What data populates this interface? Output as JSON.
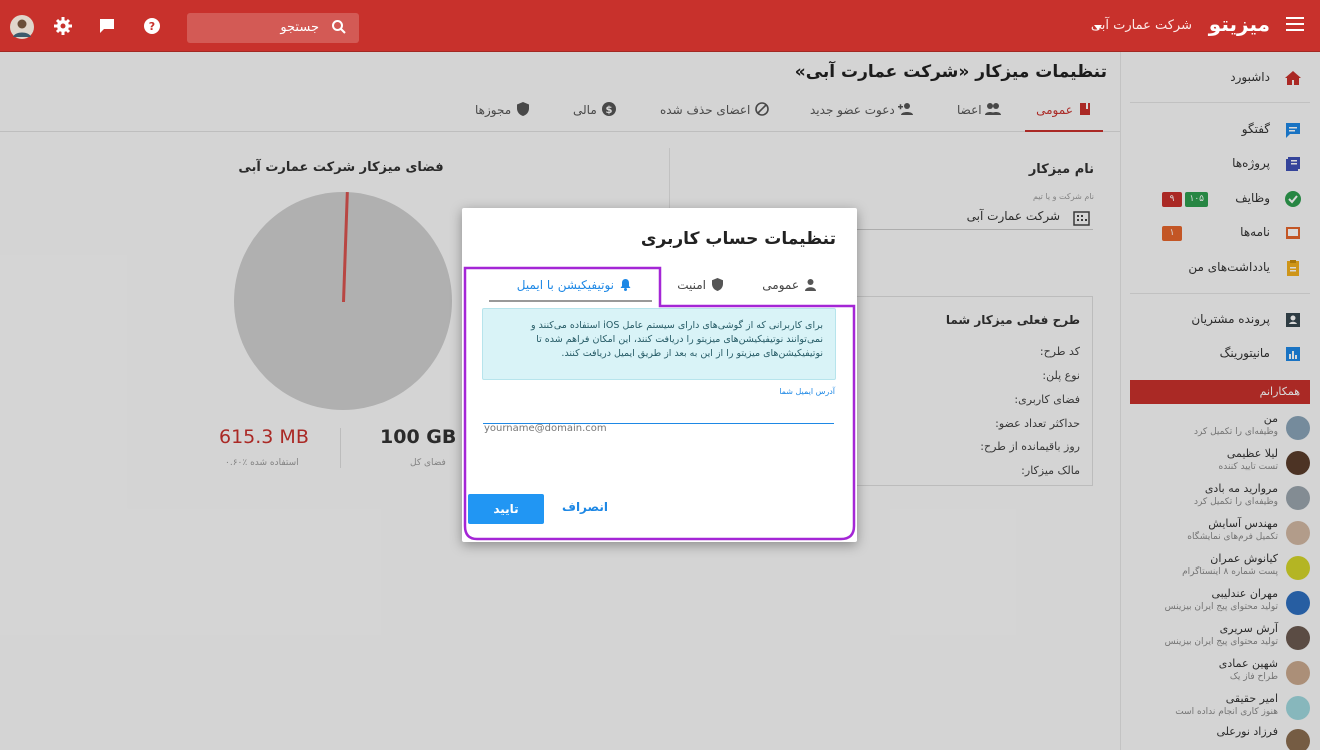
{
  "topbar": {
    "brand": "میزیتو",
    "company": "شرکت عمارت آبی",
    "search_placeholder": "جستجو",
    "icons": [
      "menu-icon",
      "search-icon",
      "help-icon",
      "chat-icon",
      "gear-icon",
      "user-avatar"
    ]
  },
  "page": {
    "title": "تنظیمات میزکار «شرکت عمارت آبی»",
    "tabs": [
      {
        "label": "عمومی",
        "icon": "book-icon",
        "active": true
      },
      {
        "label": "اعضا",
        "icon": "people-icon"
      },
      {
        "label": "دعوت عضو جدید",
        "icon": "person-add-icon"
      },
      {
        "label": "اعضای حذف شده",
        "icon": "block-icon"
      },
      {
        "label": "مالی",
        "icon": "dollar-icon"
      },
      {
        "label": "مجوزها",
        "icon": "shield-icon"
      }
    ]
  },
  "storage": {
    "title": "فضای میزکار شرکت عمارت آبی",
    "total_value": "100 GB",
    "total_label": "فضای کل",
    "used_value": "615.3 MB",
    "used_label": "۰.۶۰٪ استفاده شده",
    "used_fraction": 0.006
  },
  "workspace": {
    "name_title": "نام میزکار",
    "name_hint": "نام شرکت و یا تیم",
    "name_value": "شرکت عمارت آبی",
    "plan_title": "طرح فعلی میزکار شما",
    "plan_rows": [
      "کد طرح:",
      "نوع پلن:",
      "فضای کاربری:",
      "حداکثر تعداد عضو:",
      "روز باقیمانده از طرح:",
      "مالک میزکار:"
    ]
  },
  "sidebar": {
    "items": [
      {
        "label": "داشبورد",
        "icon": "home-icon"
      },
      {
        "label": "گفتگو",
        "icon": "chat-icon"
      },
      {
        "label": "پروژه‌ها",
        "icon": "projects-icon"
      },
      {
        "label": "وظایف",
        "icon": "check-icon",
        "badges": [
          "۱۰۵",
          "۹"
        ]
      },
      {
        "label": "نامه‌ها",
        "icon": "mail-icon",
        "badges": [
          "۱"
        ]
      },
      {
        "label": "یادداشت‌های من",
        "icon": "note-icon"
      },
      {
        "label": "پرونده مشتریان",
        "icon": "customer-icon"
      },
      {
        "label": "مانیتورینگ",
        "icon": "monitor-icon"
      }
    ],
    "colleagues_title": "همکارانم",
    "colleagues": [
      {
        "name": "من",
        "status": "وظیفه‌ای را تکمیل کرد"
      },
      {
        "name": "لیلا عظیمی",
        "status": "تست تایید کننده"
      },
      {
        "name": "مروارید مه بادی",
        "status": "وظیفه‌ای را تکمیل کرد"
      },
      {
        "name": "مهندس آسایش",
        "status": "تکمیل فرم‌های نمایشگاه"
      },
      {
        "name": "کیانوش عمران",
        "status": "پست شماره ۸ اینستاگرام"
      },
      {
        "name": "مهران عندلیبی",
        "status": "تولید محتوای پیج ایران بیزینس"
      },
      {
        "name": "آرش سریری",
        "status": "تولید محتوای پیج ایران بیزینس"
      },
      {
        "name": "شهین عمادی",
        "status": "طراح فاز یک"
      },
      {
        "name": "امیر حقیقی",
        "status": "هنوز کاری انجام نداده است"
      },
      {
        "name": "فرزاد نورعلی",
        "status": ""
      }
    ]
  },
  "dialog": {
    "title": "تنظیمات حساب کاربری",
    "tabs": [
      {
        "label": "عمومی",
        "icon": "person-icon"
      },
      {
        "label": "امنیت",
        "icon": "shield-icon"
      },
      {
        "label": "نوتیفیکیشن با ایمیل",
        "icon": "bell-icon",
        "active": true
      }
    ],
    "info": "برای کاربرانی که از گوشی‌های دارای سیستم عامل iOS استفاده می‌کنند و نمی‌توانند نوتیفیکیشن‌های میزیتو را دریافت کنند، این امکان فراهم شده تا نوتیفیکیشن‌های میزیتو را از این به بعد از طریق ایمیل دریافت کنند.",
    "email_label": "آدرس ایمیل شما",
    "email_placeholder": "yourname@domain.com",
    "confirm": "تایید",
    "cancel": "انصراف"
  },
  "colors": {
    "brand": "#c8312c",
    "accent": "#2196f3",
    "highlight": "#a426d6"
  }
}
